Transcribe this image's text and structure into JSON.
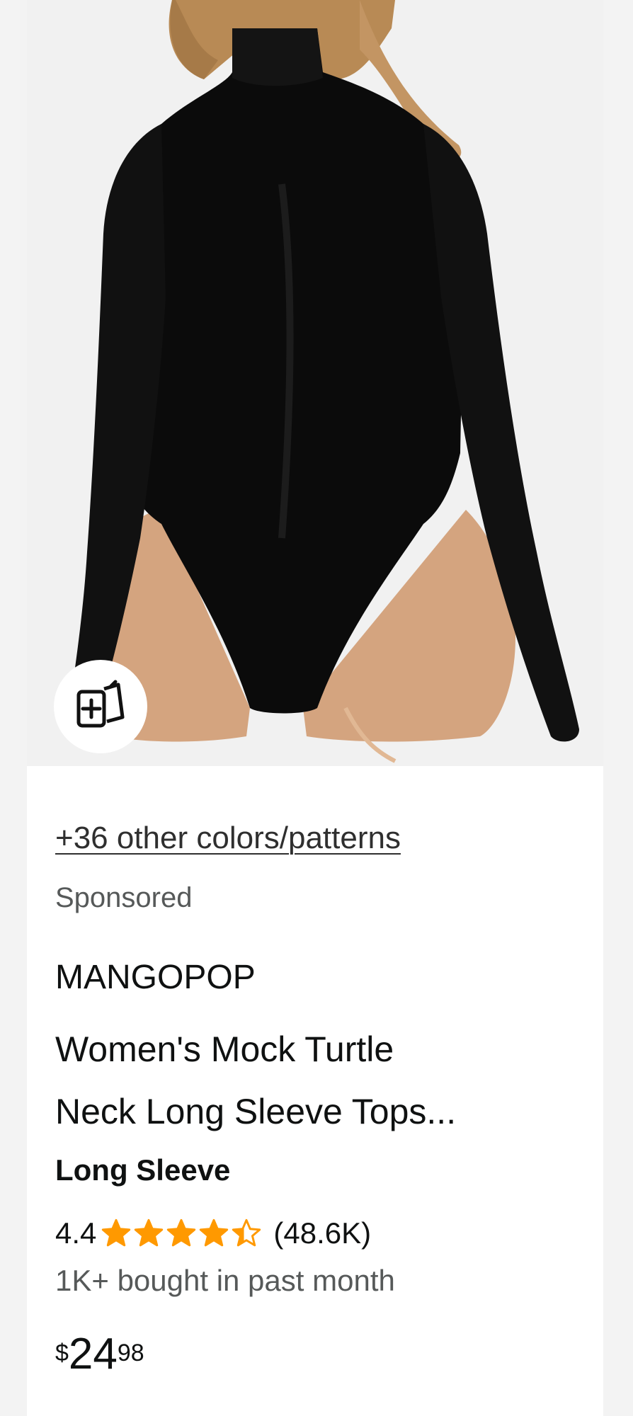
{
  "product": {
    "image_alt": "Woman wearing black mock turtleneck long sleeve bodysuit",
    "add_to_list_icon": "add-to-list-icon",
    "colors_link": "+36 other colors/patterns",
    "sponsored": "Sponsored",
    "brand": "MANGOPOP",
    "title_line1": "Women's Mock Turtle",
    "title_line2": "Neck Long Sleeve Tops...",
    "variant": "Long Sleeve",
    "rating_value": "4.4",
    "rating_stars": 4.4,
    "rating_max": 5,
    "rating_count": "(48.6K)",
    "bought": "1K+ bought in past month",
    "price_symbol": "$",
    "price_whole": "24",
    "price_fraction": "98"
  },
  "colors": {
    "star": "#ff9900",
    "text": "#0f1111",
    "muted": "#565959",
    "garment": "#0b0b0b",
    "skin": "#d4a47f",
    "hair": "#b88a55"
  }
}
